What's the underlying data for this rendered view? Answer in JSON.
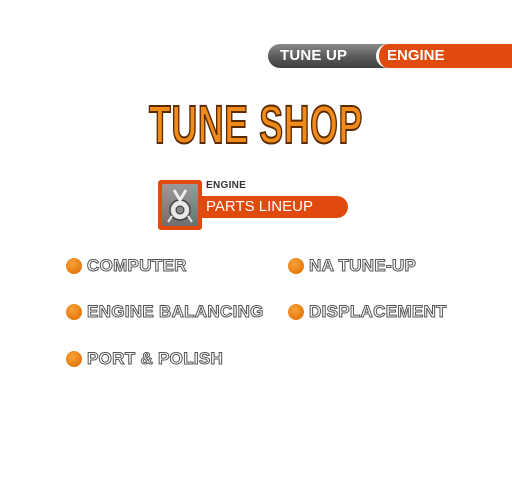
{
  "tabs": [
    {
      "label": "TUNE UP",
      "active": false
    },
    {
      "label": "ENGINE",
      "active": true
    }
  ],
  "title": "TUNE SHOP",
  "category": {
    "small_label": "ENGINE",
    "main_label": "PARTS LINEUP",
    "icon": "engine-parts-icon"
  },
  "items": [
    {
      "label": "COMPUTER"
    },
    {
      "label": "NA TUNE-UP"
    },
    {
      "label": "ENGINE BALANCING"
    },
    {
      "label": "DISPLACEMENT"
    },
    {
      "label": "PORT & POLISH"
    }
  ],
  "colors": {
    "accent": "#e04a0c",
    "title": "#f08a1a",
    "bullet": "#e57a0c"
  }
}
